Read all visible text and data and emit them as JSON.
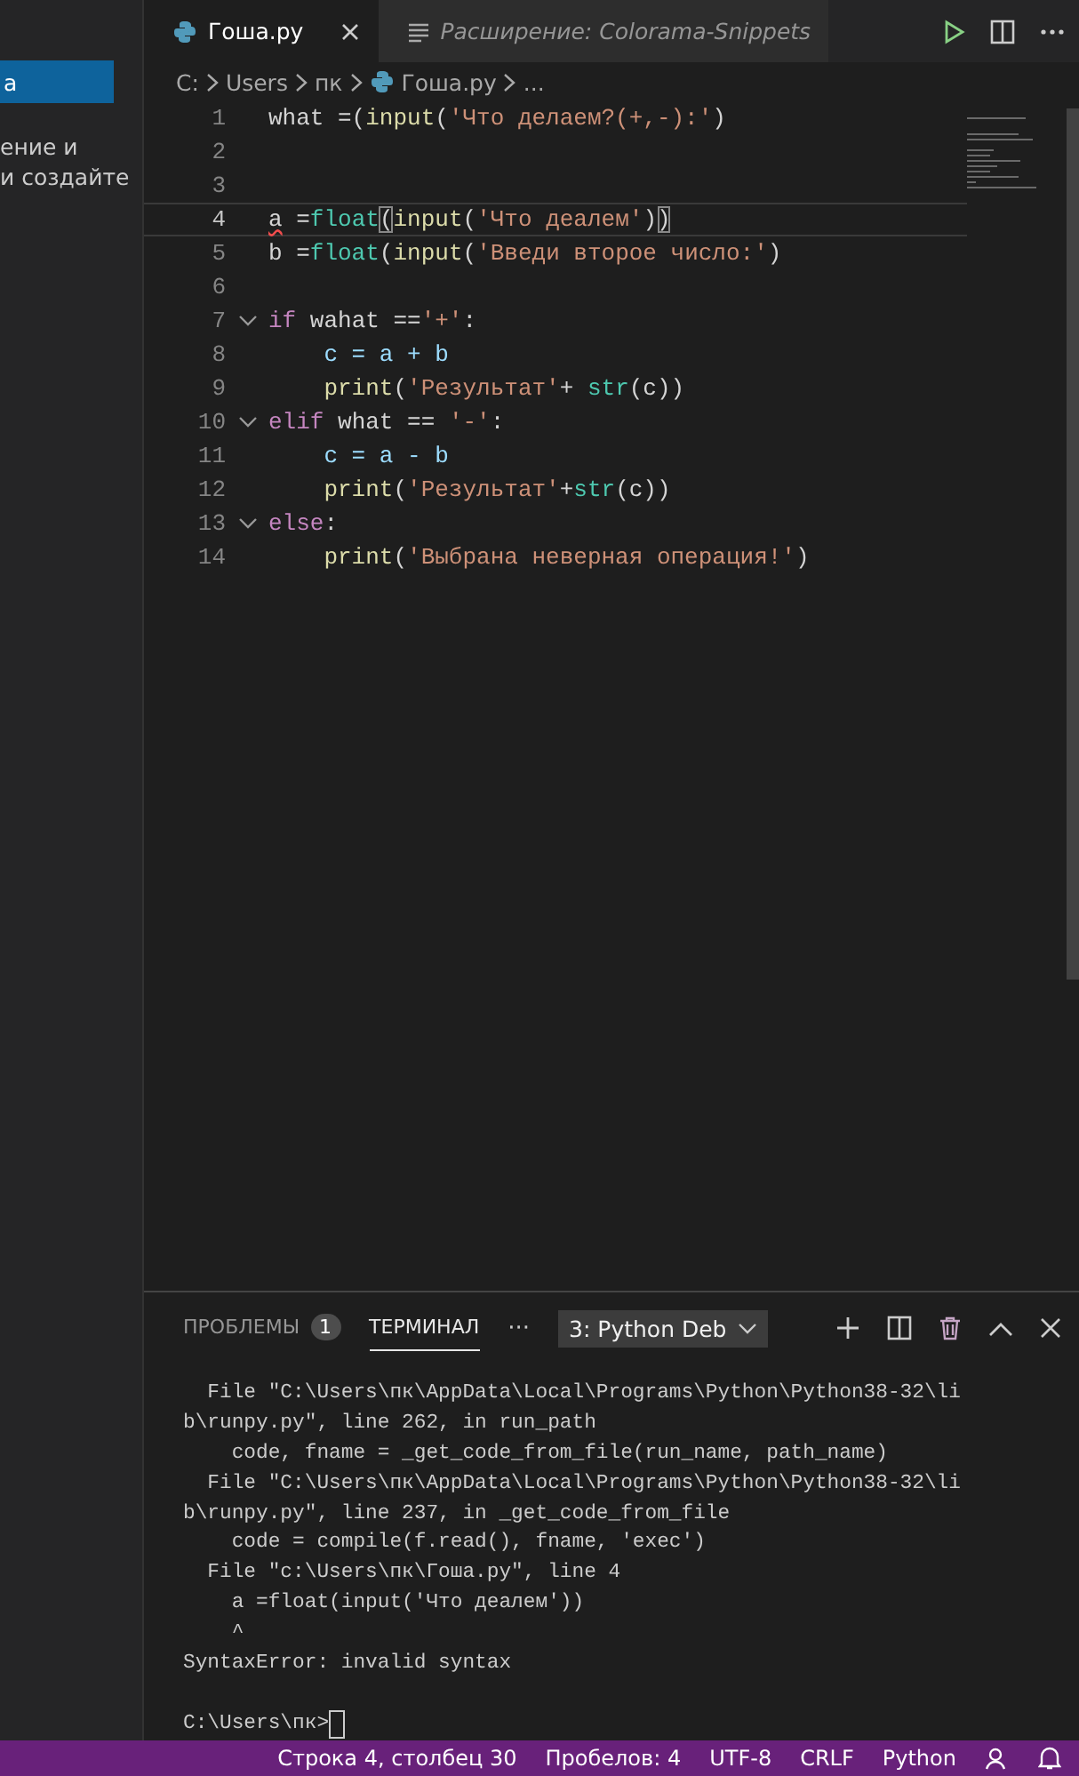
{
  "sidebar": {
    "items": [
      {
        "label": "а",
        "selected": true
      }
    ],
    "text_lines": [
      "ение и",
      "и создайте"
    ]
  },
  "tabs": [
    {
      "label": "Гоша.py",
      "selected": true,
      "kind": "python",
      "closable": true
    },
    {
      "label": "Расширение: Colorama-Snippets",
      "selected": false,
      "kind": "preview",
      "closable": false
    }
  ],
  "breadcrumbs": [
    "C:",
    "Users",
    "пк",
    "Гоша.py",
    "..."
  ],
  "code": {
    "lines": [
      {
        "number": "1",
        "current": false,
        "foldable": false,
        "tokens": [
          {
            "kind": "plain",
            "text": "what =("
          },
          {
            "kind": "func",
            "text": "input"
          },
          {
            "kind": "plain",
            "text": "("
          },
          {
            "kind": "string",
            "text": "'Что делаем?(+,-):'"
          },
          {
            "kind": "plain",
            "text": ")"
          }
        ]
      },
      {
        "number": "2",
        "current": false,
        "foldable": false
      },
      {
        "number": "3",
        "current": false,
        "foldable": false
      },
      {
        "number": "4",
        "current": true,
        "foldable": false,
        "tokens": [
          {
            "kind": "error",
            "text": "a"
          },
          {
            "kind": "plain",
            "text": " ="
          },
          {
            "kind": "class",
            "text": "float"
          },
          {
            "kind": "bracket",
            "text": "("
          },
          {
            "kind": "func",
            "text": "input"
          },
          {
            "kind": "plain",
            "text": "("
          },
          {
            "kind": "string",
            "text": "'Что деалем'"
          },
          {
            "kind": "plain",
            "text": ")"
          },
          {
            "kind": "bracket",
            "text": ")"
          }
        ]
      },
      {
        "number": "5",
        "current": false,
        "foldable": false,
        "tokens": [
          {
            "kind": "plain",
            "text": "b ="
          },
          {
            "kind": "class",
            "text": "float"
          },
          {
            "kind": "plain",
            "text": "("
          },
          {
            "kind": "func",
            "text": "input"
          },
          {
            "kind": "plain",
            "text": "("
          },
          {
            "kind": "string",
            "text": "'Введи второе число:'"
          },
          {
            "kind": "plain",
            "text": ")"
          }
        ]
      },
      {
        "number": "6",
        "current": false,
        "foldable": false
      },
      {
        "number": "7",
        "current": false,
        "foldable": true,
        "tokens": [
          {
            "kind": "keyword",
            "text": "if"
          },
          {
            "kind": "plain",
            "text": " wahat =="
          },
          {
            "kind": "string",
            "text": "'+'"
          },
          {
            "kind": "plain",
            "text": ":"
          }
        ]
      },
      {
        "number": "8",
        "current": false,
        "foldable": false,
        "tokens": [
          {
            "kind": "var",
            "text": "    c = a + b"
          }
        ]
      },
      {
        "number": "9",
        "current": false,
        "foldable": false,
        "tokens": [
          {
            "kind": "func",
            "text": "    print"
          },
          {
            "kind": "plain",
            "text": "("
          },
          {
            "kind": "string",
            "text": "'Результат'"
          },
          {
            "kind": "plain",
            "text": "+ "
          },
          {
            "kind": "class",
            "text": "str"
          },
          {
            "kind": "plain",
            "text": "(c))"
          }
        ]
      },
      {
        "number": "10",
        "current": false,
        "foldable": true,
        "tokens": [
          {
            "kind": "keyword",
            "text": "elif"
          },
          {
            "kind": "plain",
            "text": " what == "
          },
          {
            "kind": "string",
            "text": "'-'"
          },
          {
            "kind": "plain",
            "text": ":"
          }
        ]
      },
      {
        "number": "11",
        "current": false,
        "foldable": false,
        "tokens": [
          {
            "kind": "var",
            "text": "    c = a - b"
          }
        ]
      },
      {
        "number": "12",
        "current": false,
        "foldable": false,
        "tokens": [
          {
            "kind": "func",
            "text": "    print"
          },
          {
            "kind": "plain",
            "text": "("
          },
          {
            "kind": "string",
            "text": "'Результат'"
          },
          {
            "kind": "plain",
            "text": "+"
          },
          {
            "kind": "class",
            "text": "str"
          },
          {
            "kind": "plain",
            "text": "(c))"
          }
        ]
      },
      {
        "number": "13",
        "current": false,
        "foldable": true,
        "tokens": [
          {
            "kind": "keyword",
            "text": "else"
          },
          {
            "kind": "plain",
            "text": ":"
          }
        ]
      },
      {
        "number": "14",
        "current": false,
        "foldable": false,
        "tokens": [
          {
            "kind": "func",
            "text": "    print"
          },
          {
            "kind": "plain",
            "text": "("
          },
          {
            "kind": "string",
            "text": "'Выбрана неверная операция!'"
          },
          {
            "kind": "plain",
            "text": ")"
          }
        ]
      }
    ]
  },
  "panel": {
    "tabs": [
      {
        "label": "ПРОБЛЕМЫ",
        "badge": "1",
        "selected": false
      },
      {
        "label": "ТЕРМИНАЛ",
        "selected": true
      }
    ],
    "more": "···",
    "terminal_select": "3: Python Deb",
    "terminal_lines": [
      "  File \"C:\\Users\\пк\\AppData\\Local\\Programs\\Python\\Python38-32\\li",
      "b\\runpy.py\", line 262, in run_path",
      "    code, fname = _get_code_from_file(run_name, path_name)",
      "  File \"C:\\Users\\пк\\AppData\\Local\\Programs\\Python\\Python38-32\\li",
      "b\\runpy.py\", line 237, in _get_code_from_file",
      "    code = compile(f.read(), fname, 'exec')",
      "  File \"c:\\Users\\пк\\Гоша.py\", line 4",
      "    a =float(input('Что деалем'))",
      "    ^",
      "SyntaxError: invalid syntax"
    ],
    "prompt": "C:\\Users\\пк>"
  },
  "status_bar": [
    "Строка 4, столбец 30",
    "Пробелов: 4",
    "UTF-8",
    "CRLF",
    "Python"
  ]
}
